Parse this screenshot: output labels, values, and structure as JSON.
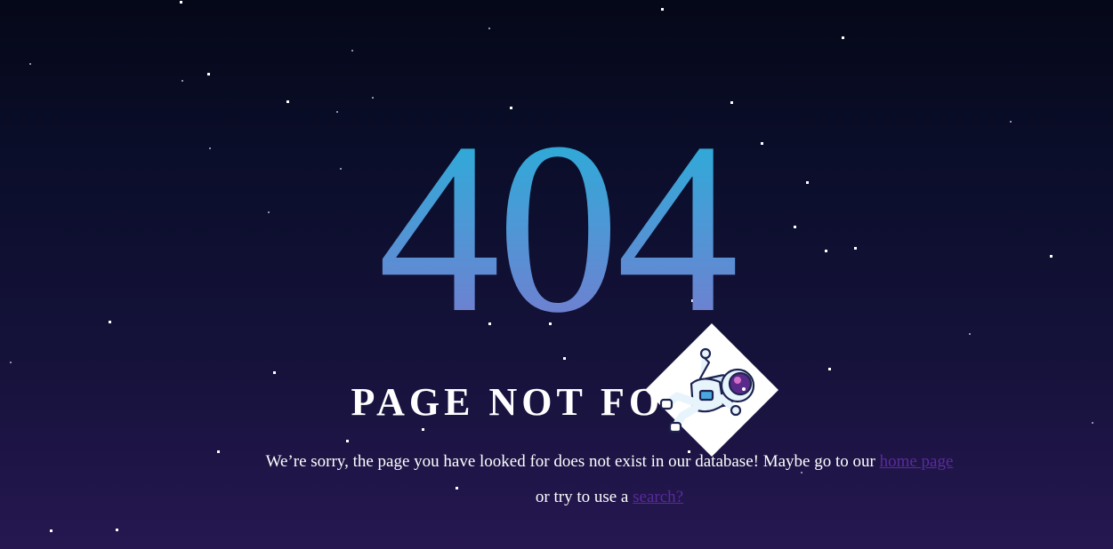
{
  "error": {
    "code": "404",
    "title": "PAGE NOT FOUND"
  },
  "message": {
    "text_before": "We’re sorry, the page you have looked for does not exist in our database! Maybe go to our ",
    "home_link": "home page",
    "text_middle": " or try to use a ",
    "search_link": "search?"
  },
  "illustration": {
    "icon": "floating-astronaut-icon"
  },
  "colors": {
    "background_top": "#050818",
    "background_bottom": "#261751",
    "code_gradient_top": "#20b2d8",
    "code_gradient_bottom": "#7a78cf",
    "link": "#5b2a9e",
    "text": "#ffffff"
  }
}
